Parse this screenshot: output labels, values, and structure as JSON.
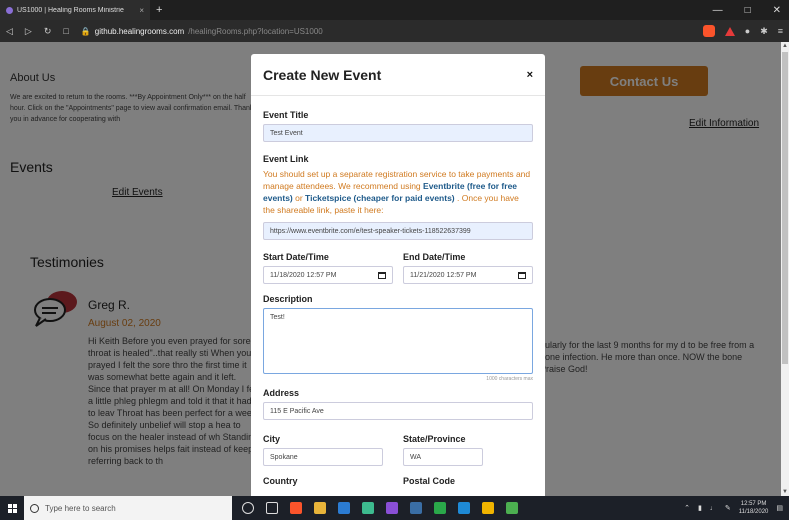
{
  "browser": {
    "tab_title": "US1000 | Healing Rooms Ministrie",
    "tab_close": "×",
    "new_tab": "+",
    "url_host": "github.healingrooms.com",
    "url_path": "/healingRooms.php?location=US1000"
  },
  "page": {
    "about_heading": "About Us",
    "about_text": "We are excited to return to the rooms. ***By Appointment Only*** on the half hour. Click on the \"Appointments\" page to view avail confirmation email. Thank you in advance for cooperating with",
    "contact_button": "Contact Us",
    "edit_information": "Edit Information",
    "events_heading": "Events",
    "edit_events": "Edit Events",
    "testimonies_heading": "Testimonies",
    "testimony_name": "Greg R.",
    "testimony_date": "August 02, 2020",
    "testimony_text": "Hi Keith Before you even prayed for sore throat is healed\"..that really sti When you prayed I felt the sore thro the first time it was somewhat bette again and it left. Since that prayer m at all! On Monday I felt a little phleg phlegm and told it that it had to leav Throat has been perfect for a week So definitely unbelief will stop a hea to focus on the healer instead of wh Standing on his promises helps fait instead of keep referring back to th",
    "testimony_text_right": "gularly for the last 9 months for my d to be free from a bone infection. He more than once. NOW the bone Praise God!"
  },
  "modal": {
    "title": "Create New Event",
    "close": "×",
    "event_title_label": "Event Title",
    "event_title_value": "Test Event",
    "event_link_label": "Event Link",
    "help_part1": "You should set up a separate registration service to take payments and manage attendees. We recommend using ",
    "help_link1": "Eventbrite (free for free events)",
    "help_or": " or ",
    "help_link2": "Ticketspice (cheaper for paid events)",
    "help_part2": " . Once you have the shareable link, paste it here:",
    "event_link_value": "https://www.eventbrite.com/e/test-speaker-tickets-118522637399",
    "start_label": "Start Date/Time",
    "start_value": "11/18/2020 12:57 PM",
    "end_label": "End Date/Time",
    "end_value": "11/21/2020 12:57 PM",
    "description_label": "Description",
    "description_value": "Test!",
    "char_counter": "1000 characters max",
    "address_label": "Address",
    "address_value": "115 E Pacific Ave",
    "city_label": "City",
    "city_value": "Spokane",
    "state_label": "State/Province",
    "state_value": "WA",
    "country_label": "Country",
    "postal_label": "Postal Code"
  },
  "taskbar": {
    "search_placeholder": "Type here to search",
    "time": "12:57 PM",
    "date": "11/18/2020"
  }
}
